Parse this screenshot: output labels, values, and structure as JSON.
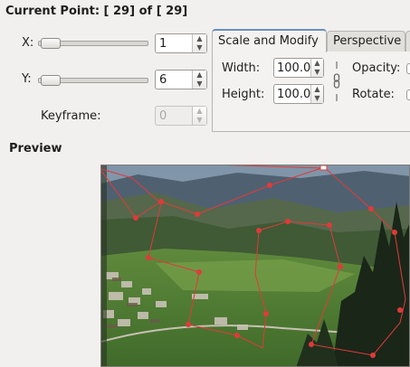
{
  "header": {
    "prefix": "Current Point: [",
    "current": " 29",
    "of": "] of [",
    "total": " 29",
    "suffix": "]"
  },
  "point": {
    "x": {
      "label": "X:",
      "value": "1",
      "slider_fraction": 0.0
    },
    "y": {
      "label": "Y:",
      "value": "6",
      "slider_fraction": 0.0
    },
    "keyframe": {
      "label": "Keyframe:",
      "value": "0"
    }
  },
  "tabs": [
    {
      "label": "Scale and Modify",
      "active": true
    },
    {
      "label": "Perspective",
      "active": false
    }
  ],
  "scale": {
    "width_label": "Width:",
    "width_value": "100.0",
    "height_label": "Height:",
    "height_value": "100.0",
    "opacity_label": "Opacity:",
    "rotate_label": "Rotate:"
  },
  "preview": {
    "label": "Preview",
    "path_color": "#e03a3a",
    "icons": {
      "chain": "chain-link-icon"
    }
  },
  "colors": {
    "background": "#f1f0ee",
    "accent": "#6a8fbd"
  }
}
